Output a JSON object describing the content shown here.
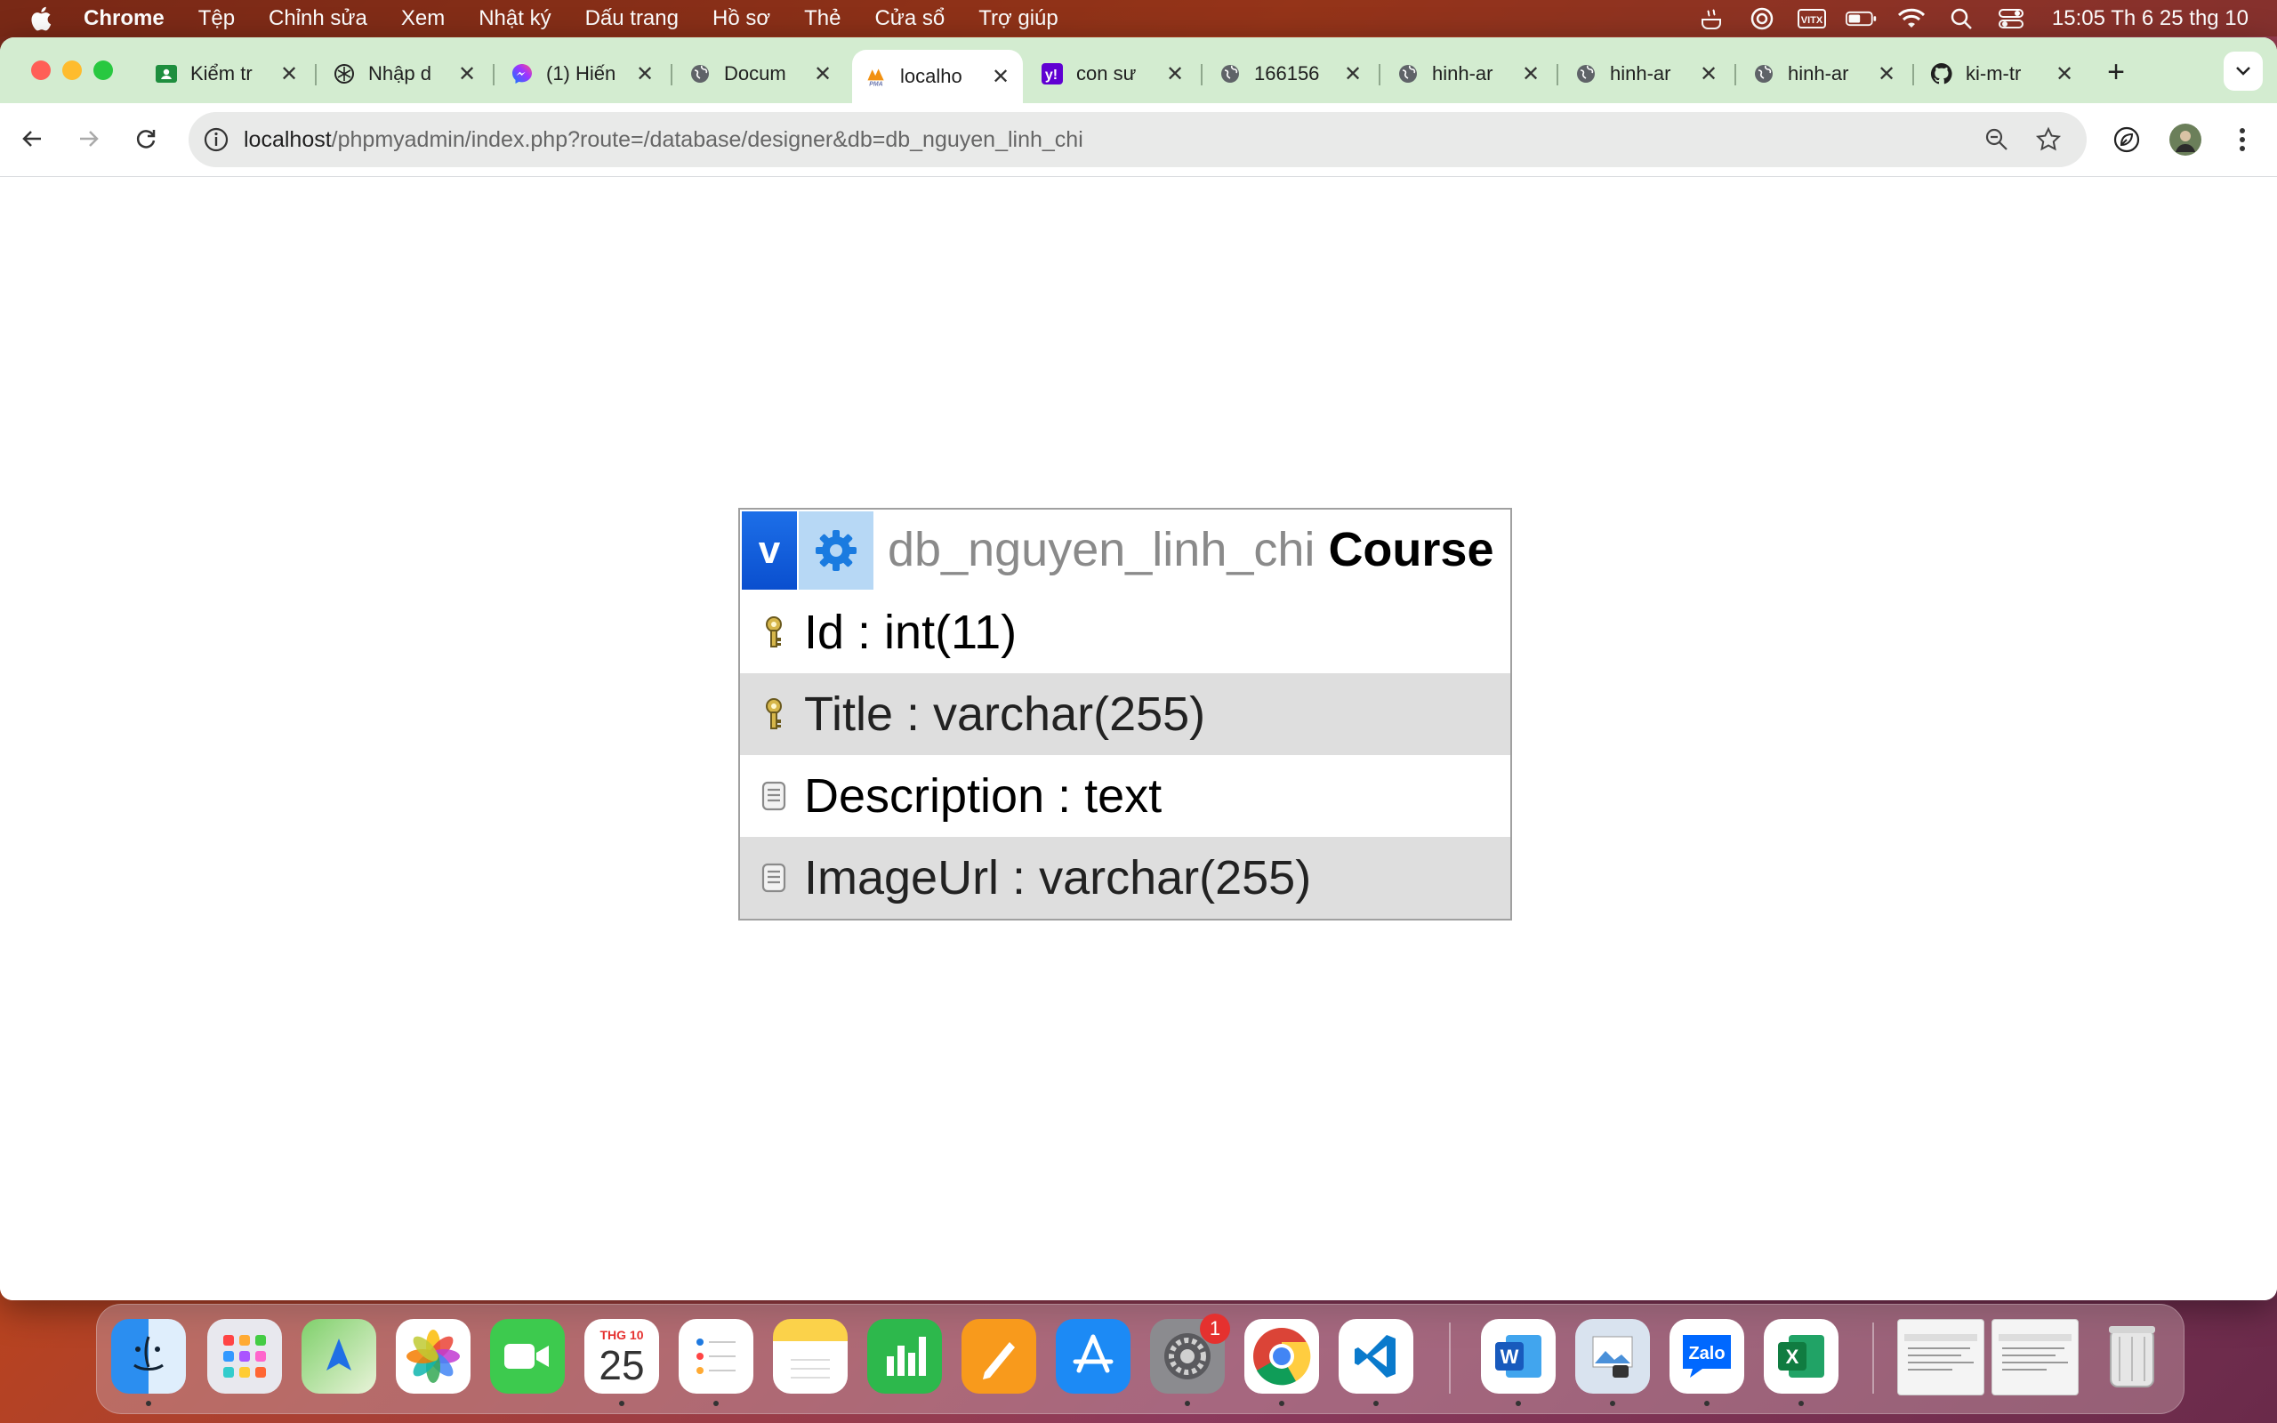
{
  "menubar": {
    "app_name": "Chrome",
    "items": [
      "Tệp",
      "Chỉnh sửa",
      "Xem",
      "Nhật ký",
      "Dấu trang",
      "Hồ sơ",
      "Thẻ",
      "Cửa sổ",
      "Trợ giúp"
    ],
    "clock": "15:05 Th 6 25 thg 10"
  },
  "tabs": [
    {
      "title": "Kiểm tr",
      "icon": "google-classroom-icon",
      "active": false
    },
    {
      "title": "Nhập d",
      "icon": "chatgpt-icon",
      "active": false
    },
    {
      "title": "(1) Hiến",
      "icon": "messenger-icon",
      "active": false
    },
    {
      "title": "Docum",
      "icon": "globe-icon",
      "active": false
    },
    {
      "title": "localho",
      "icon": "phpmyadmin-icon",
      "active": true
    },
    {
      "title": "con sư",
      "icon": "yahoo-icon",
      "active": false
    },
    {
      "title": "166156",
      "icon": "globe-icon",
      "active": false
    },
    {
      "title": "hinh-ar",
      "icon": "globe-icon",
      "active": false
    },
    {
      "title": "hinh-ar",
      "icon": "globe-icon",
      "active": false
    },
    {
      "title": "hinh-ar",
      "icon": "globe-icon",
      "active": false
    },
    {
      "title": "ki-m-tr",
      "icon": "github-icon",
      "active": false
    }
  ],
  "address": {
    "host": "localhost",
    "path": "/phpmyadmin/index.php?route=/database/designer&db=db_nguyen_linh_chi"
  },
  "designer": {
    "v_label": "v",
    "database": "db_nguyen_linh_chi",
    "table": "Course",
    "columns": [
      {
        "text": "Id : int(11)",
        "icon": "primary-key-icon"
      },
      {
        "text": "Title : varchar(255)",
        "icon": "primary-key-icon"
      },
      {
        "text": "Description : text",
        "icon": "column-field-icon"
      },
      {
        "text": "ImageUrl : varchar(255)",
        "icon": "column-field-icon"
      }
    ]
  },
  "dock": {
    "calendar_month": "THG 10",
    "calendar_day": "25",
    "settings_badge": "1",
    "word_letter": "W",
    "excel_letter": "X",
    "zalo_label": "Zalo"
  },
  "colors": {
    "tabstrip": "#d3ecd0",
    "designer_header_blue": "#1d6fe8",
    "row_alt": "#dedede"
  }
}
